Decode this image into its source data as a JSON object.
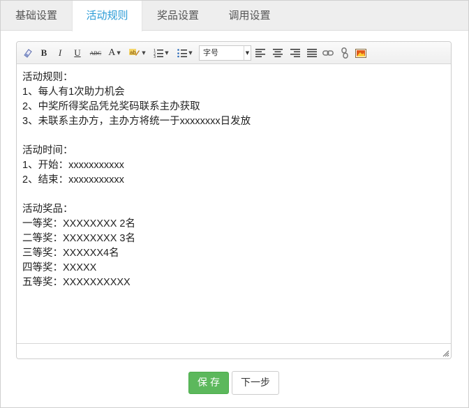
{
  "tabs": [
    {
      "label": "基础设置",
      "active": false
    },
    {
      "label": "活动规则",
      "active": true
    },
    {
      "label": "奖品设置",
      "active": false
    },
    {
      "label": "调用设置",
      "active": false
    }
  ],
  "toolbar": {
    "font_size_select": "字号",
    "icons": [
      "eraser-icon",
      "bold-icon",
      "italic-icon",
      "underline-icon",
      "strikethrough-icon",
      "font-color-icon",
      "highlight-icon",
      "ordered-list-icon",
      "unordered-list-icon",
      "font-size-select",
      "align-left-icon",
      "align-center-icon",
      "align-right-icon",
      "justify-icon",
      "link-icon",
      "unlink-icon",
      "image-icon"
    ],
    "bold": "B",
    "italic": "I",
    "underline": "U",
    "strike": "ABC",
    "fontcolor": "A"
  },
  "content": {
    "lines": [
      "活动规则：",
      "1、每人有1次助力机会",
      "2、中奖所得奖品凭兑奖码联系主办获取",
      "3、未联系主办方，主办方将统一于xxxxxxxx日发放",
      "",
      "活动时间：",
      "1、开始：xxxxxxxxxxx",
      "2、结束：xxxxxxxxxxx",
      "",
      "活动奖品：",
      "一等奖：XXXXXXXX 2名",
      "二等奖：XXXXXXXX 3名",
      "三等奖：XXXXXX4名",
      "四等奖：XXXXX",
      "五等奖：XXXXXXXXXX"
    ]
  },
  "buttons": {
    "save": "保存",
    "next": "下一步",
    "save_color": "#5cb85c"
  },
  "colors": {
    "active_tab_text": "#2a9bd6",
    "tabbar_bg": "#eeeeee"
  }
}
